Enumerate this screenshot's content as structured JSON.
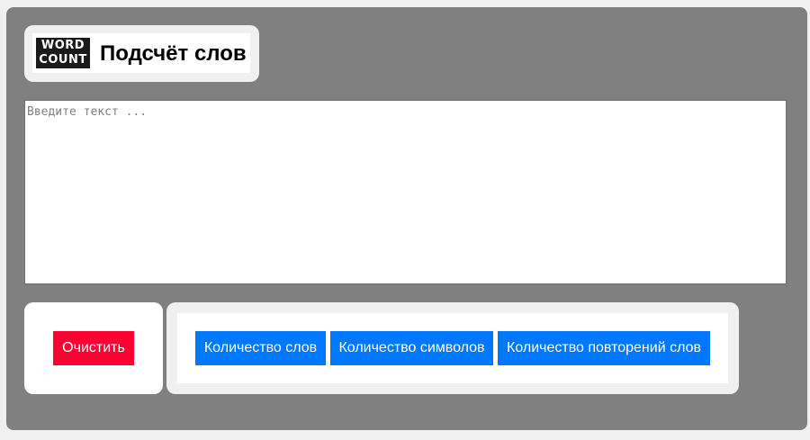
{
  "header": {
    "logo_line1": "WORD",
    "logo_line2": "COUNT",
    "title": "Подсчёт слов"
  },
  "text_input": {
    "placeholder": "Введите текст ...",
    "value": ""
  },
  "buttons": {
    "clear_label": "Очистить",
    "count_words_label": "Количество слов",
    "count_chars_label": "Количество символов",
    "count_repeats_label": "Количество повторений слов"
  },
  "colors": {
    "app_background": "#808080",
    "panel_background": "#f0f0f0",
    "clear_button": "#ff0033",
    "action_button": "#0077ff"
  },
  "icons": {
    "logo": "word-count-logo"
  }
}
